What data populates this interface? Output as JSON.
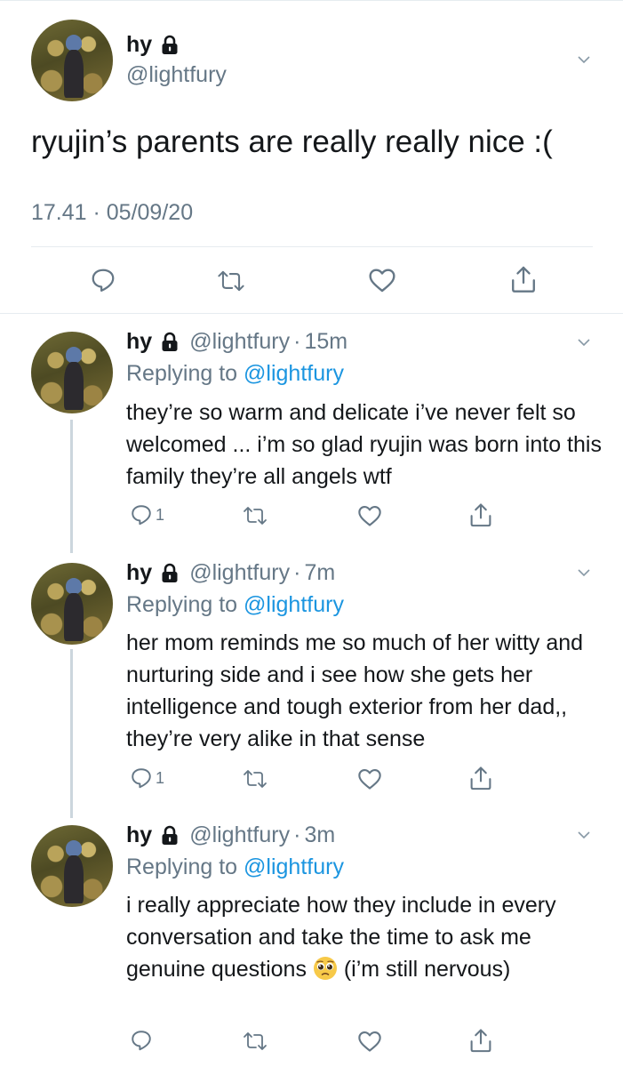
{
  "main_tweet": {
    "name": "hy",
    "handle": "@lightfury",
    "text": "ryujin’s parents are really really nice :(",
    "timestamp": "17.41 · 05/09/20"
  },
  "replies": [
    {
      "name": "hy",
      "handle": "@lightfury",
      "sep": "·",
      "time": "15m",
      "replying_prefix": "Replying to ",
      "replying_handle": "@lightfury",
      "text": "they’re so warm and delicate i’ve never felt so welcomed ... i’m so glad ryujin was born into this family they’re all angels wtf",
      "reply_count": "1"
    },
    {
      "name": "hy",
      "handle": "@lightfury",
      "sep": "·",
      "time": "7m",
      "replying_prefix": "Replying to ",
      "replying_handle": "@lightfury",
      "text": "her mom reminds me so much of her witty and nurturing side and i see how she gets her intelligence and tough exterior from her dad,, they’re very alike in that sense",
      "reply_count": "1"
    },
    {
      "name": "hy",
      "handle": "@lightfury",
      "sep": "·",
      "time": "3m",
      "replying_prefix": "Replying to ",
      "replying_handle": "@lightfury",
      "text_before_emoji": "i really appreciate how they include in every conversation and take the time to ask me genuine questions ",
      "text_after_emoji": "  (i’m still nervous)",
      "emoji_icon": "pleading-face-emoji"
    }
  ],
  "icons": {
    "reply": "reply-bubble-icon",
    "retweet": "retweet-icon",
    "like": "heart-icon",
    "share": "share-icon",
    "more": "chevron-down-icon",
    "protected": "lock-icon"
  },
  "colors": {
    "text": "#14171a",
    "secondary": "#657786",
    "link": "#1b95e0",
    "divider": "#e6ecf0"
  }
}
